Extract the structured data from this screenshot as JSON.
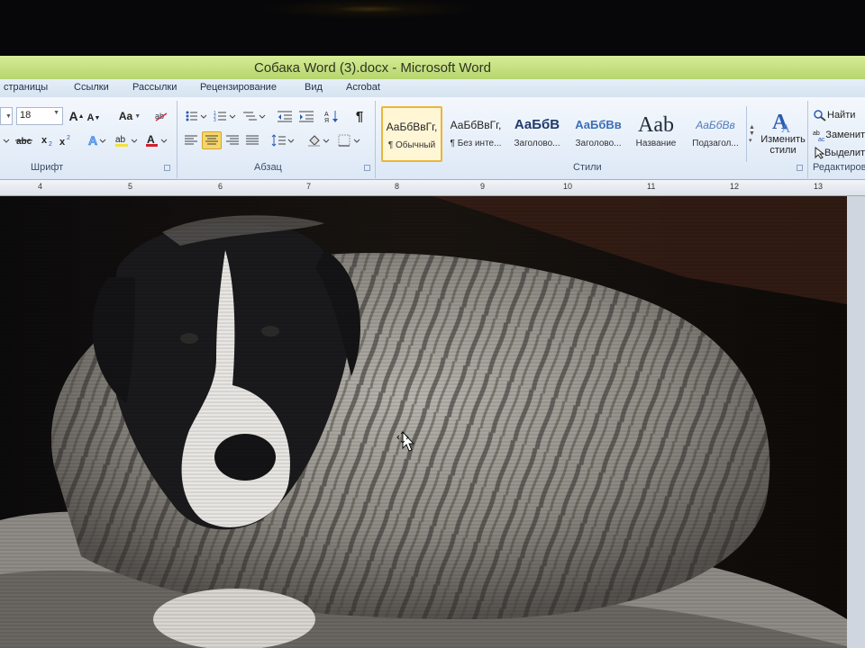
{
  "window": {
    "title": "Собака Word (3).docx - Microsoft Word"
  },
  "tabs": [
    "страницы",
    "Ссылки",
    "Рассылки",
    "Рецензирование",
    "Вид",
    "Acrobat"
  ],
  "font": {
    "size_value": "18",
    "grow_label": "A",
    "shrink_label": "A",
    "case_label": "Aa",
    "group_label": "Шрифт"
  },
  "paragraph": {
    "group_label": "Абзац",
    "pilcrow": "¶"
  },
  "styles": {
    "group_label": "Стили",
    "items": [
      {
        "sample": "АаБбВвГг,",
        "name": "¶ Обычный"
      },
      {
        "sample": "АаБбВвГг,",
        "name": "¶ Без инте..."
      },
      {
        "sample": "АаБбВ",
        "name": "Заголово..."
      },
      {
        "sample": "АаБбВв",
        "name": "Заголово..."
      },
      {
        "sample": "Aab",
        "name": "Название"
      },
      {
        "sample": "АаБбВв",
        "name": "Подзагол..."
      }
    ],
    "change_label_1": "Изменить",
    "change_label_2": "стили"
  },
  "editing": {
    "find_label": "Найти",
    "replace_label": "Заменит",
    "select_label": "Выделит",
    "group_label": "Редактирова"
  },
  "ruler": {
    "ticks": [
      "4",
      "5",
      "6",
      "7",
      "8",
      "9",
      "10",
      "11",
      "12",
      "13"
    ]
  },
  "colors": {
    "title_bar": "#c6e07e",
    "ribbon": "#e8f0fa",
    "highlight": "#f6d56a",
    "font_color": "#d0202a"
  },
  "icons": [
    "bullets-icon",
    "numbering-icon",
    "multilevel-list-icon",
    "decrease-indent-icon",
    "increase-indent-icon",
    "sort-icon",
    "show-marks-icon",
    "align-left-icon",
    "align-center-icon",
    "align-right-icon",
    "justify-icon",
    "line-spacing-icon",
    "shading-icon",
    "borders-icon",
    "find-icon",
    "replace-icon",
    "select-icon",
    "change-styles-icon",
    "move-cursor-icon"
  ]
}
